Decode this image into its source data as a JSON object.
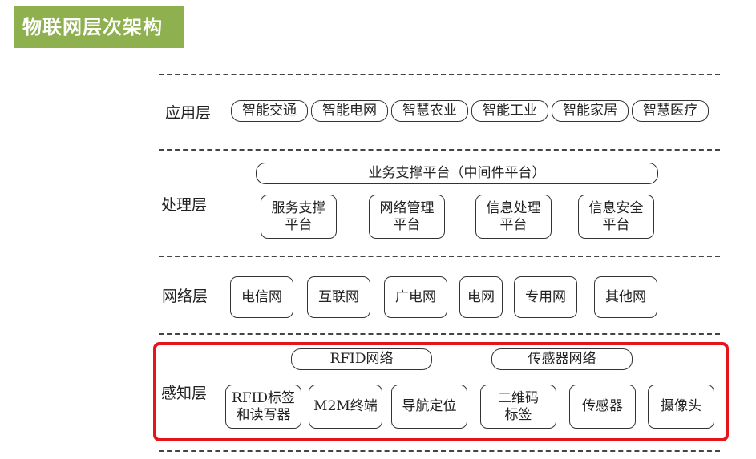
{
  "title": "物联网层次架构",
  "layers": {
    "application": {
      "label": "应用层",
      "items": [
        "智能交通",
        "智能电网",
        "智慧农业",
        "智能工业",
        "智能家居",
        "智慧医疗"
      ]
    },
    "processing": {
      "label": "处理层",
      "platform": "业务支撑平台（中间件平台）",
      "items": [
        "服务支撑\n平台",
        "网络管理\n平台",
        "信息处理\n平台",
        "信息安全\n平台"
      ]
    },
    "network": {
      "label": "网络层",
      "items": [
        "电信网",
        "互联网",
        "广电网",
        "电网",
        "专用网",
        "其他网"
      ]
    },
    "perception": {
      "label": "感知层",
      "networks": [
        "RFID网络",
        "传感器网络"
      ],
      "items": [
        "RFID标签\n和读写器",
        "M2M终端",
        "导航定位",
        "二维码\n标签",
        "传感器",
        "摄像头"
      ]
    }
  },
  "colors": {
    "title_bg": "#8fb04f",
    "highlight": "#e8141c"
  }
}
